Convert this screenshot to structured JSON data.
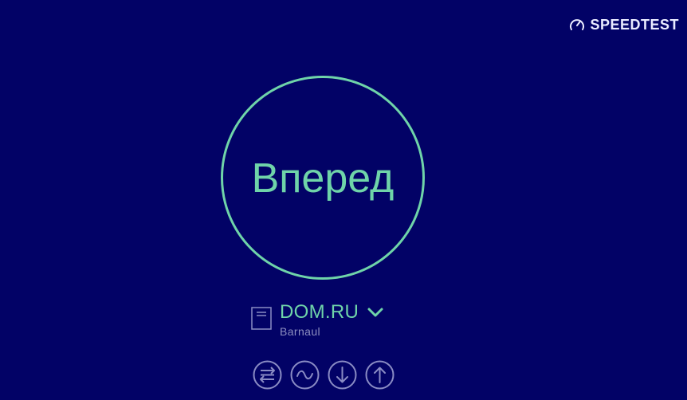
{
  "brand": {
    "name": "SPEEDTEST",
    "icon": "speedometer-icon"
  },
  "go_button": {
    "label": "Вперед"
  },
  "server": {
    "provider": "DOM.RU",
    "location": "Barnaul",
    "icon": "server-icon",
    "dropdown_icon": "chevron-down-icon"
  },
  "modes": [
    {
      "icon": "multi-connection-icon"
    },
    {
      "icon": "wave-icon"
    },
    {
      "icon": "download-arrow-icon"
    },
    {
      "icon": "upload-arrow-icon"
    }
  ],
  "colors": {
    "background": "#020266",
    "accent": "#6fd4a9",
    "brand_text": "#e9ebff",
    "muted_text": "#8d8fc0",
    "icon_gray": "#8a8cc4"
  }
}
